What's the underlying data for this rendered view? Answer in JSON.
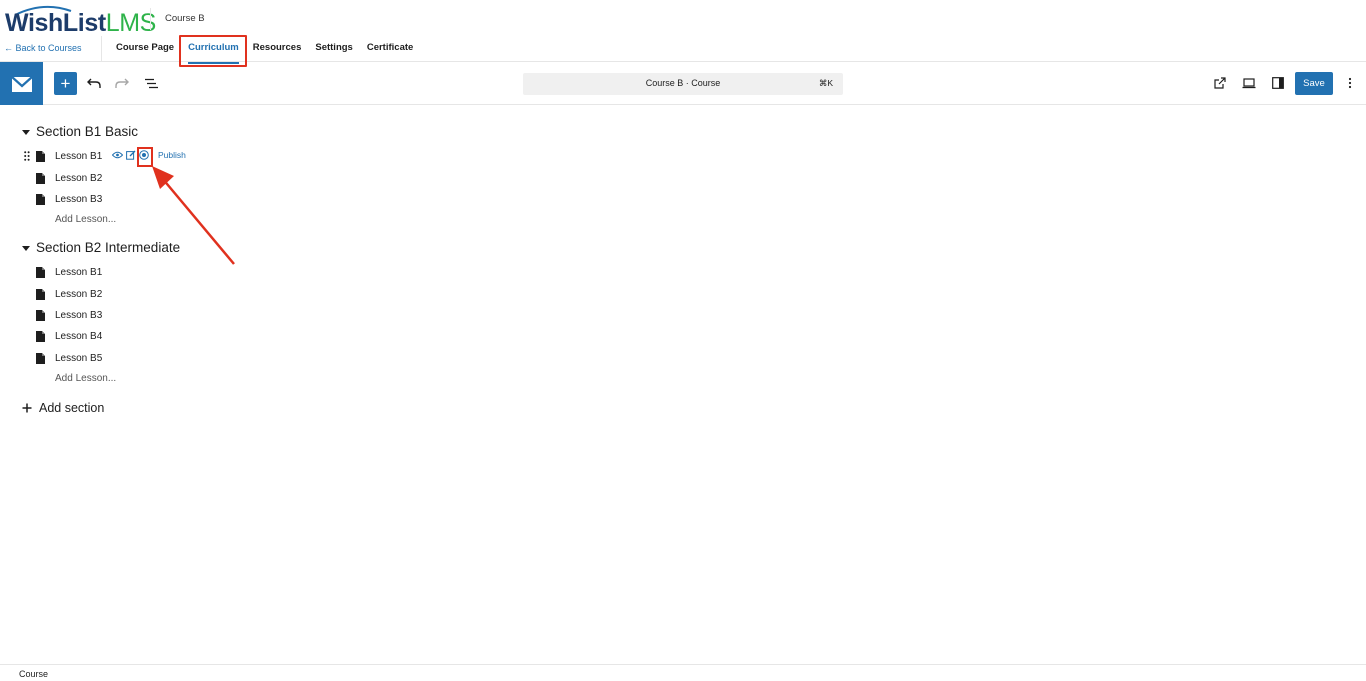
{
  "app": {
    "logo_text_primary": "WishList",
    "logo_text_secondary": "LMS",
    "course_title": "Course B"
  },
  "header": {
    "back_link": "← Back to Courses",
    "tabs": [
      {
        "label": "Course Page",
        "active": false
      },
      {
        "label": "Curriculum",
        "active": true
      },
      {
        "label": "Resources",
        "active": false
      },
      {
        "label": "Settings",
        "active": false
      },
      {
        "label": "Certificate",
        "active": false
      }
    ]
  },
  "toolbar": {
    "add_label": "+",
    "command_bar_text": "Course B · Course",
    "command_bar_shortcut": "⌘K",
    "save_label": "Save",
    "icons": [
      "wordpress-logo-icon",
      "plus-icon",
      "undo-icon",
      "redo-icon",
      "list-view-icon",
      "external-link-icon",
      "device-preview-icon",
      "sidebar-toggle-icon",
      "more-options-icon"
    ]
  },
  "curriculum": {
    "sections": [
      {
        "title": "Section B1 Basic",
        "lessons": [
          "Lesson B1",
          "Lesson B2",
          "Lesson B3"
        ],
        "add_lesson_label": "Add Lesson..."
      },
      {
        "title": "Section B2 Intermediate",
        "lessons": [
          "Lesson B1",
          "Lesson B2",
          "Lesson B3",
          "Lesson B4",
          "Lesson B5"
        ],
        "add_lesson_label": "Add Lesson..."
      }
    ],
    "hover_actions": {
      "publish_label": "Publish",
      "icons": [
        "eye-icon",
        "edit-icon",
        "publish-status-icon"
      ]
    },
    "add_section_label": "Add section"
  },
  "footer": {
    "breadcrumb": "Course"
  },
  "colors": {
    "accent": "#2271b1",
    "annotation_red": "#e0311e",
    "logo_blue": "#1d3c6a",
    "logo_green": "#2eb34a"
  }
}
